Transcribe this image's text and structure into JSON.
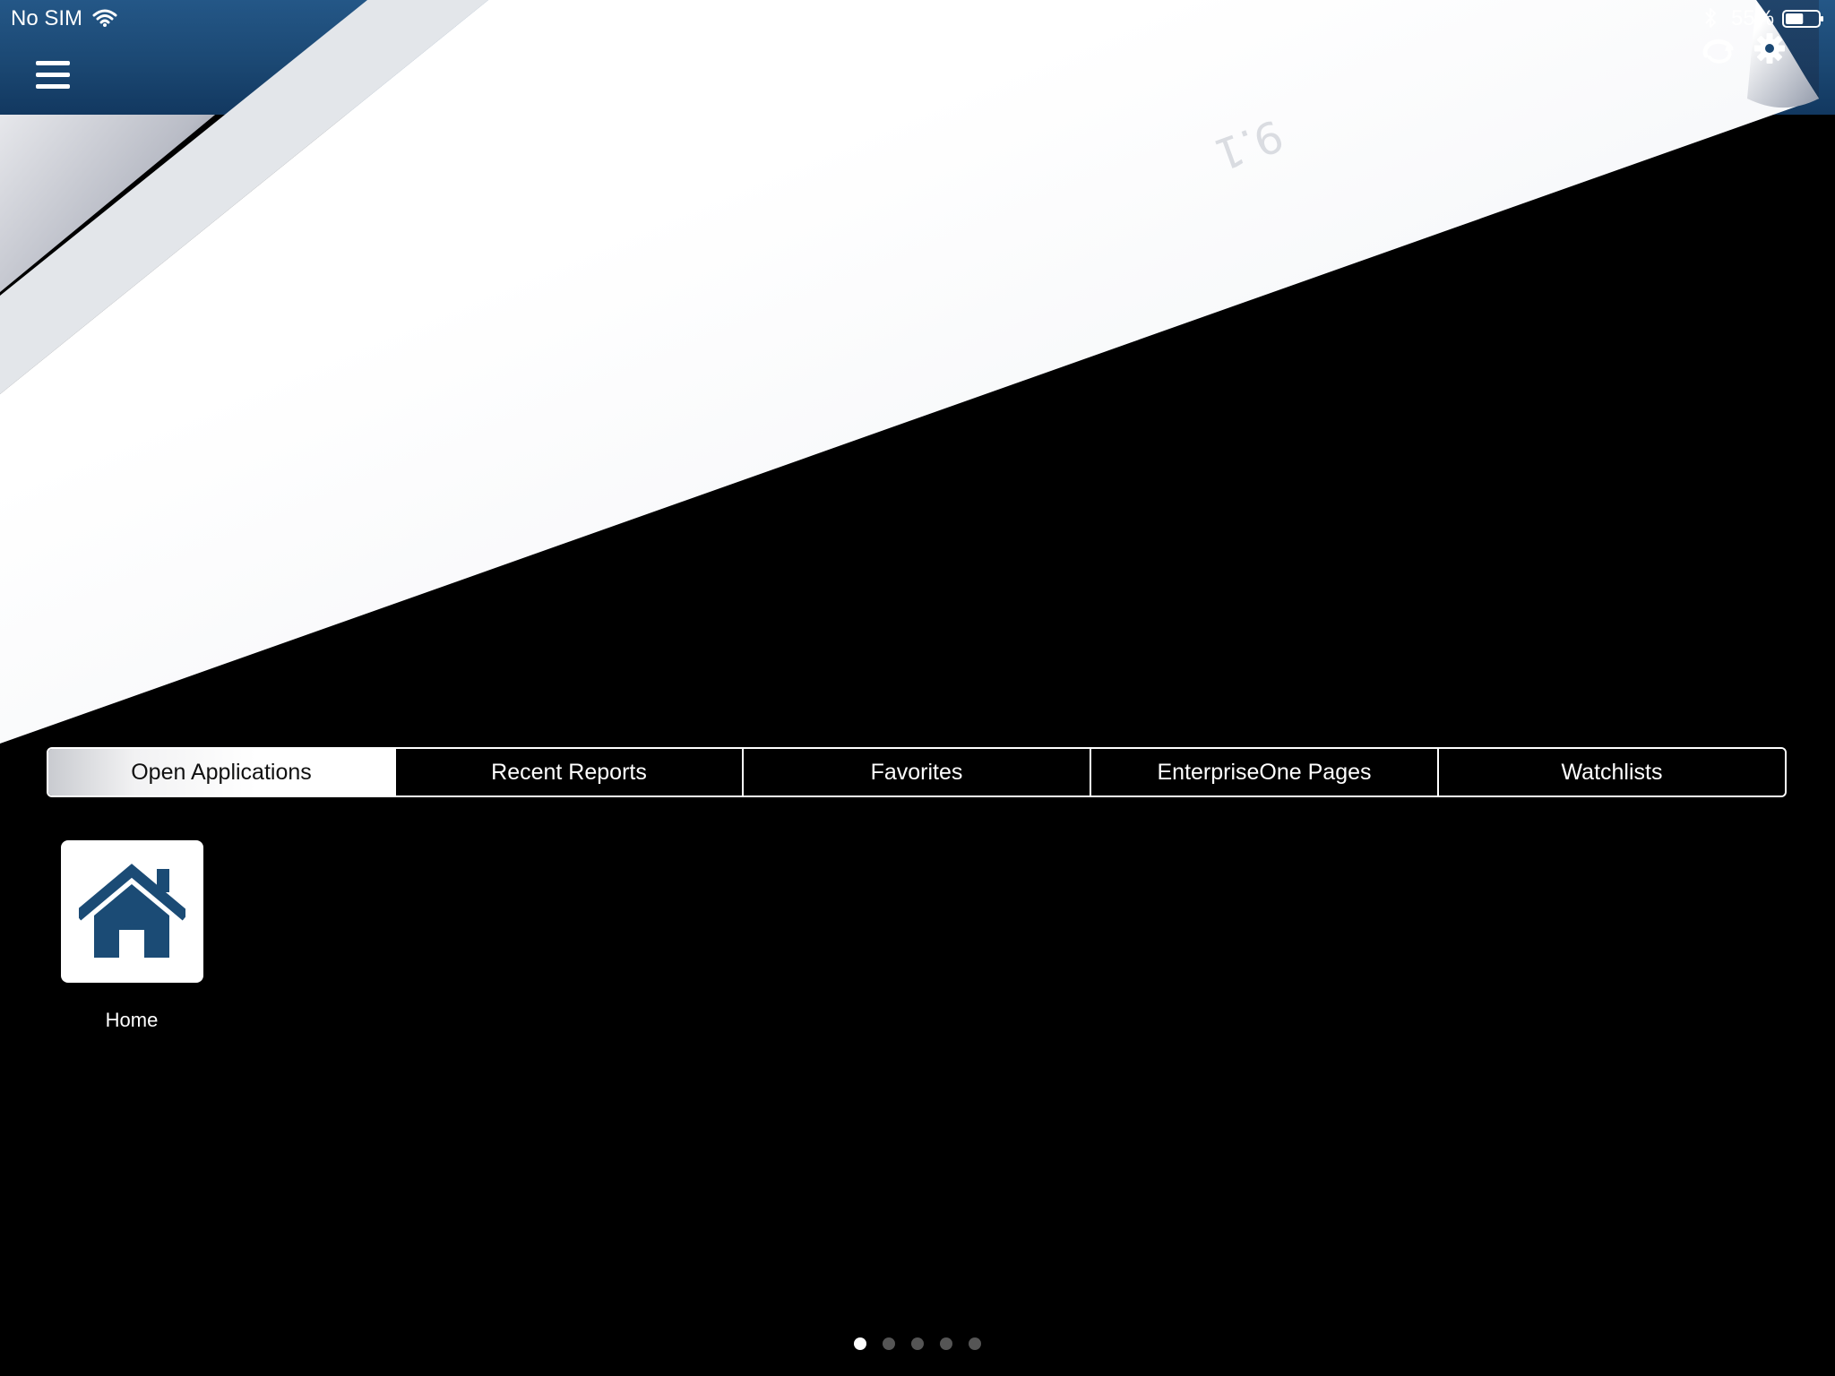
{
  "status_bar": {
    "carrier": "No SIM",
    "battery_percent": "55%",
    "battery_level": 0.55,
    "icons": [
      "wifi-icon",
      "bluetooth-icon",
      "battery-icon"
    ]
  },
  "header": {
    "menu_icon": "hamburger-menu-icon",
    "sync_icon": "sync-icon",
    "settings_icon": "gear-icon",
    "brand_color": "#1b4873"
  },
  "background": {
    "watermark_text": "9.1"
  },
  "tabs": [
    {
      "label": "Open Applications",
      "active": true
    },
    {
      "label": "Recent Reports",
      "active": false
    },
    {
      "label": "Favorites",
      "active": false
    },
    {
      "label": "EnterpriseOne Pages",
      "active": false
    },
    {
      "label": "Watchlists",
      "active": false
    }
  ],
  "apps": [
    {
      "label": "Home",
      "icon": "home-icon",
      "icon_color": "#1b4b75"
    }
  ],
  "pagination": {
    "page_count": 5,
    "current_page": 1
  }
}
